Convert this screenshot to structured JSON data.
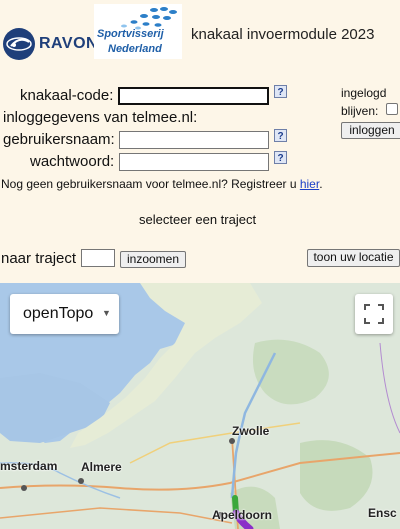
{
  "header": {
    "ravon_text": "RAVON",
    "sv_line1": "Sportvisserij",
    "sv_line2": "Nederland",
    "title": "knakaal invoermodule 2023"
  },
  "form": {
    "knakaal_label": "knakaal-code:",
    "login_heading": "inloggegevens van telmee.nl:",
    "username_label": "gebruikersnaam:",
    "password_label": "wachtwoord:",
    "help_glyph": "?",
    "stay_logged_1": "ingelogd",
    "stay_logged_2": "blijven:",
    "login_button": "inloggen",
    "register_text": "Nog geen gebruikersnaam voor telmee.nl? Registreer u",
    "register_link": "hier",
    "register_end": ".",
    "select_traject": "selecteer een traject",
    "naar_traject_label": "naar traject",
    "zoom_button": "inzoomen",
    "location_button": "toon uw locatie"
  },
  "map": {
    "layer_label": "openTopo",
    "cities": [
      "Zwolle",
      "msterdam",
      "Almere",
      "Apeldoorn",
      "Ensc"
    ],
    "colors": {
      "water": "#a9c8e8",
      "land": "#dfe8dc",
      "track_green": "#3aa83a",
      "track_purple": "#8a2fc8"
    }
  }
}
